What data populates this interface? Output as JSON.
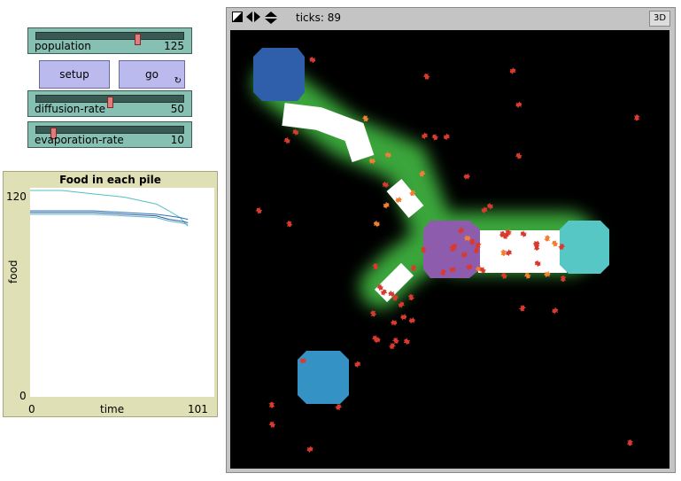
{
  "sliders": {
    "population": {
      "label": "population",
      "value": "125",
      "fraction": 0.7
    },
    "diffusion": {
      "label": "diffusion-rate",
      "value": "50",
      "fraction": 0.5
    },
    "evaporation": {
      "label": "evaporation-rate",
      "value": "10",
      "fraction": 0.1
    }
  },
  "buttons": {
    "setup": "setup",
    "go": "go",
    "go_icon": "forever-icon"
  },
  "plot": {
    "title": "Food in each pile",
    "ylabel": "food",
    "xlabel": "time",
    "y_max": "120",
    "y_min": "0",
    "x_min": "0",
    "x_max": "101"
  },
  "chart_data": {
    "type": "line",
    "title": "Food in each pile",
    "xlabel": "time",
    "ylabel": "food",
    "xlim": [
      0,
      101
    ],
    "ylim": [
      0,
      120
    ],
    "series": [
      {
        "color": "#52c1c1",
        "x": [
          0,
          20,
          40,
          60,
          80,
          88,
          95,
          100
        ],
        "y": [
          120,
          120,
          118,
          116,
          112,
          108,
          104,
          99
        ]
      },
      {
        "color": "#2a73b8",
        "x": [
          0,
          20,
          40,
          60,
          80,
          88,
          95,
          100
        ],
        "y": [
          108,
          108,
          108,
          107,
          106,
          105,
          104,
          103
        ]
      },
      {
        "color": "#2d58a0",
        "x": [
          0,
          20,
          40,
          60,
          80,
          88,
          95,
          100
        ],
        "y": [
          107,
          107,
          107,
          106,
          105,
          103,
          102,
          101
        ]
      },
      {
        "color": "#5cb4c9",
        "x": [
          0,
          20,
          40,
          60,
          80,
          88,
          95,
          100
        ],
        "y": [
          106,
          106,
          106,
          105,
          104,
          102,
          101,
          100
        ]
      }
    ]
  },
  "view": {
    "ticks_label": "ticks:",
    "ticks_value": "89",
    "three_d": "3D",
    "icons": [
      "speed-toggle-icon",
      "step-arrows-icon",
      "vertical-arrows-icon"
    ],
    "colors": {
      "nest": "#8e5cad",
      "pile1": "#56c7c4",
      "pile2": "#2f5eab",
      "pile3": "#3592c4",
      "ant": "#d93a2f",
      "ant_carrying": "#f07f35",
      "chemical": "#2f8f2f"
    }
  }
}
